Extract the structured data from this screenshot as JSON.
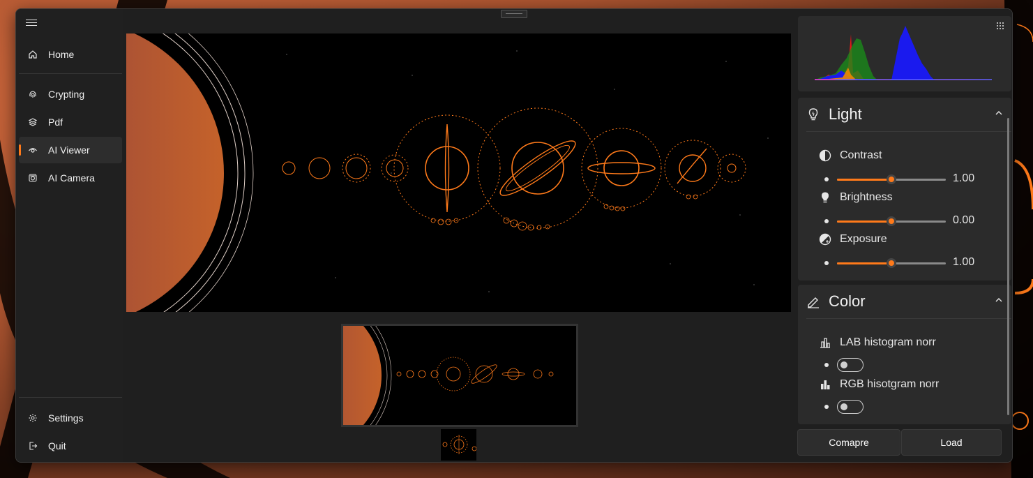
{
  "nav": {
    "items": [
      {
        "label": "Home",
        "icon": "home-icon"
      },
      {
        "label": "Crypting",
        "icon": "fingerprint-icon"
      },
      {
        "label": "Pdf",
        "icon": "layers-icon"
      },
      {
        "label": "AI Viewer",
        "icon": "eye-icon",
        "active": true
      },
      {
        "label": "AI Camera",
        "icon": "camera-icon"
      }
    ],
    "footer": [
      {
        "label": "Settings",
        "icon": "gear-icon"
      },
      {
        "label": "Quit",
        "icon": "exit-icon"
      }
    ]
  },
  "right": {
    "light": {
      "title": "Light",
      "items": [
        {
          "label": "Contrast",
          "value": "1.00",
          "level": 0.5,
          "icon": "contrast-icon"
        },
        {
          "label": "Brightness",
          "value": "0.00",
          "level": 0.5,
          "icon": "bulb-icon"
        },
        {
          "label": "Exposure",
          "value": "1.00",
          "level": 0.5,
          "icon": "exposure-icon"
        }
      ]
    },
    "color": {
      "title": "Color",
      "toggles": [
        {
          "label": "LAB histogram norr",
          "on": false,
          "icon": "bar-chart-icon"
        },
        {
          "label": "RGB hisotgram norr",
          "on": false,
          "icon": "bar-chart-filled-icon"
        }
      ]
    }
  },
  "buttons": {
    "compare": "Comapre",
    "load": "Load"
  },
  "colors": {
    "accent": "#ff7a1a",
    "window": "#1f1f1f",
    "card": "#2b2b2b"
  }
}
